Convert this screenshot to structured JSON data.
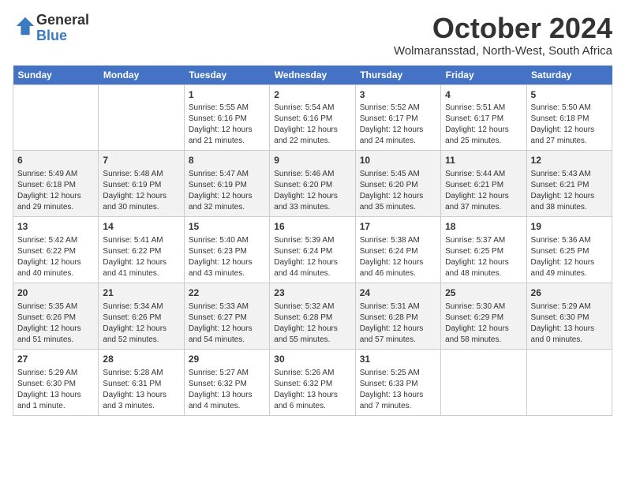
{
  "header": {
    "logo_line1": "General",
    "logo_line2": "Blue",
    "month": "October 2024",
    "location": "Wolmaransstad, North-West, South Africa"
  },
  "weekdays": [
    "Sunday",
    "Monday",
    "Tuesday",
    "Wednesday",
    "Thursday",
    "Friday",
    "Saturday"
  ],
  "weeks": [
    [
      {
        "day": "",
        "text": ""
      },
      {
        "day": "",
        "text": ""
      },
      {
        "day": "1",
        "text": "Sunrise: 5:55 AM\nSunset: 6:16 PM\nDaylight: 12 hours and 21 minutes."
      },
      {
        "day": "2",
        "text": "Sunrise: 5:54 AM\nSunset: 6:16 PM\nDaylight: 12 hours and 22 minutes."
      },
      {
        "day": "3",
        "text": "Sunrise: 5:52 AM\nSunset: 6:17 PM\nDaylight: 12 hours and 24 minutes."
      },
      {
        "day": "4",
        "text": "Sunrise: 5:51 AM\nSunset: 6:17 PM\nDaylight: 12 hours and 25 minutes."
      },
      {
        "day": "5",
        "text": "Sunrise: 5:50 AM\nSunset: 6:18 PM\nDaylight: 12 hours and 27 minutes."
      }
    ],
    [
      {
        "day": "6",
        "text": "Sunrise: 5:49 AM\nSunset: 6:18 PM\nDaylight: 12 hours and 29 minutes."
      },
      {
        "day": "7",
        "text": "Sunrise: 5:48 AM\nSunset: 6:19 PM\nDaylight: 12 hours and 30 minutes."
      },
      {
        "day": "8",
        "text": "Sunrise: 5:47 AM\nSunset: 6:19 PM\nDaylight: 12 hours and 32 minutes."
      },
      {
        "day": "9",
        "text": "Sunrise: 5:46 AM\nSunset: 6:20 PM\nDaylight: 12 hours and 33 minutes."
      },
      {
        "day": "10",
        "text": "Sunrise: 5:45 AM\nSunset: 6:20 PM\nDaylight: 12 hours and 35 minutes."
      },
      {
        "day": "11",
        "text": "Sunrise: 5:44 AM\nSunset: 6:21 PM\nDaylight: 12 hours and 37 minutes."
      },
      {
        "day": "12",
        "text": "Sunrise: 5:43 AM\nSunset: 6:21 PM\nDaylight: 12 hours and 38 minutes."
      }
    ],
    [
      {
        "day": "13",
        "text": "Sunrise: 5:42 AM\nSunset: 6:22 PM\nDaylight: 12 hours and 40 minutes."
      },
      {
        "day": "14",
        "text": "Sunrise: 5:41 AM\nSunset: 6:22 PM\nDaylight: 12 hours and 41 minutes."
      },
      {
        "day": "15",
        "text": "Sunrise: 5:40 AM\nSunset: 6:23 PM\nDaylight: 12 hours and 43 minutes."
      },
      {
        "day": "16",
        "text": "Sunrise: 5:39 AM\nSunset: 6:24 PM\nDaylight: 12 hours and 44 minutes."
      },
      {
        "day": "17",
        "text": "Sunrise: 5:38 AM\nSunset: 6:24 PM\nDaylight: 12 hours and 46 minutes."
      },
      {
        "day": "18",
        "text": "Sunrise: 5:37 AM\nSunset: 6:25 PM\nDaylight: 12 hours and 48 minutes."
      },
      {
        "day": "19",
        "text": "Sunrise: 5:36 AM\nSunset: 6:25 PM\nDaylight: 12 hours and 49 minutes."
      }
    ],
    [
      {
        "day": "20",
        "text": "Sunrise: 5:35 AM\nSunset: 6:26 PM\nDaylight: 12 hours and 51 minutes."
      },
      {
        "day": "21",
        "text": "Sunrise: 5:34 AM\nSunset: 6:26 PM\nDaylight: 12 hours and 52 minutes."
      },
      {
        "day": "22",
        "text": "Sunrise: 5:33 AM\nSunset: 6:27 PM\nDaylight: 12 hours and 54 minutes."
      },
      {
        "day": "23",
        "text": "Sunrise: 5:32 AM\nSunset: 6:28 PM\nDaylight: 12 hours and 55 minutes."
      },
      {
        "day": "24",
        "text": "Sunrise: 5:31 AM\nSunset: 6:28 PM\nDaylight: 12 hours and 57 minutes."
      },
      {
        "day": "25",
        "text": "Sunrise: 5:30 AM\nSunset: 6:29 PM\nDaylight: 12 hours and 58 minutes."
      },
      {
        "day": "26",
        "text": "Sunrise: 5:29 AM\nSunset: 6:30 PM\nDaylight: 13 hours and 0 minutes."
      }
    ],
    [
      {
        "day": "27",
        "text": "Sunrise: 5:29 AM\nSunset: 6:30 PM\nDaylight: 13 hours and 1 minute."
      },
      {
        "day": "28",
        "text": "Sunrise: 5:28 AM\nSunset: 6:31 PM\nDaylight: 13 hours and 3 minutes."
      },
      {
        "day": "29",
        "text": "Sunrise: 5:27 AM\nSunset: 6:32 PM\nDaylight: 13 hours and 4 minutes."
      },
      {
        "day": "30",
        "text": "Sunrise: 5:26 AM\nSunset: 6:32 PM\nDaylight: 13 hours and 6 minutes."
      },
      {
        "day": "31",
        "text": "Sunrise: 5:25 AM\nSunset: 6:33 PM\nDaylight: 13 hours and 7 minutes."
      },
      {
        "day": "",
        "text": ""
      },
      {
        "day": "",
        "text": ""
      }
    ]
  ]
}
